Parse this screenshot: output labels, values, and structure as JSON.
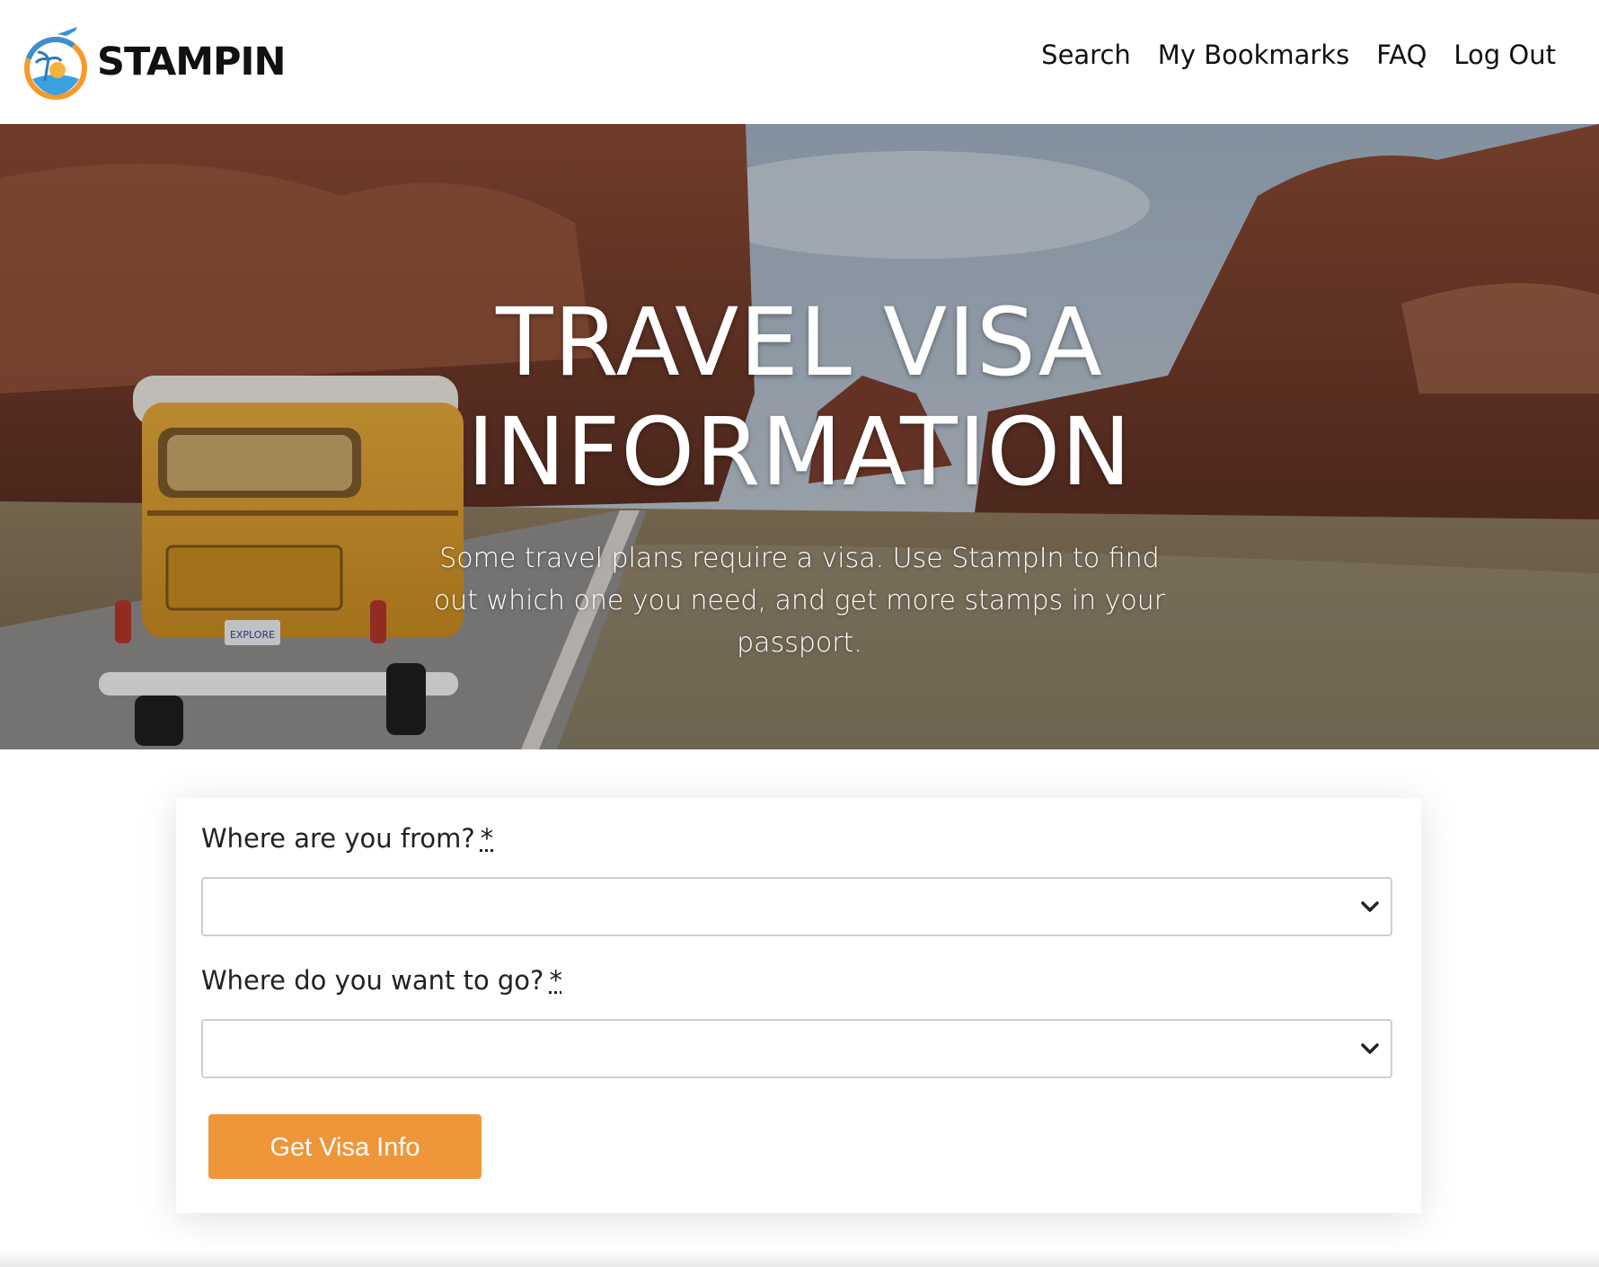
{
  "brand": {
    "name": "STAMPIN"
  },
  "nav": {
    "items": [
      {
        "label": "Search"
      },
      {
        "label": "My Bookmarks"
      },
      {
        "label": "FAQ"
      },
      {
        "label": "Log Out"
      }
    ]
  },
  "hero": {
    "title_line1": "TRAVEL VISA",
    "title_line2": "INFORMATION",
    "subtitle": "Some travel plans require a visa. Use StampIn to find out which one you need, and get more stamps in your passport.",
    "license_plate": "EXPLORE"
  },
  "form": {
    "from_label": "Where are you from?",
    "from_required": "*",
    "from_value": "",
    "to_label": "Where do you want to go?",
    "to_required": "*",
    "to_value": "",
    "submit_label": "Get Visa Info"
  },
  "colors": {
    "accent": "#f0963a",
    "text": "#111111",
    "border": "#cfcfcf"
  },
  "icons": [
    "logo-icon",
    "chevron-down-icon"
  ]
}
